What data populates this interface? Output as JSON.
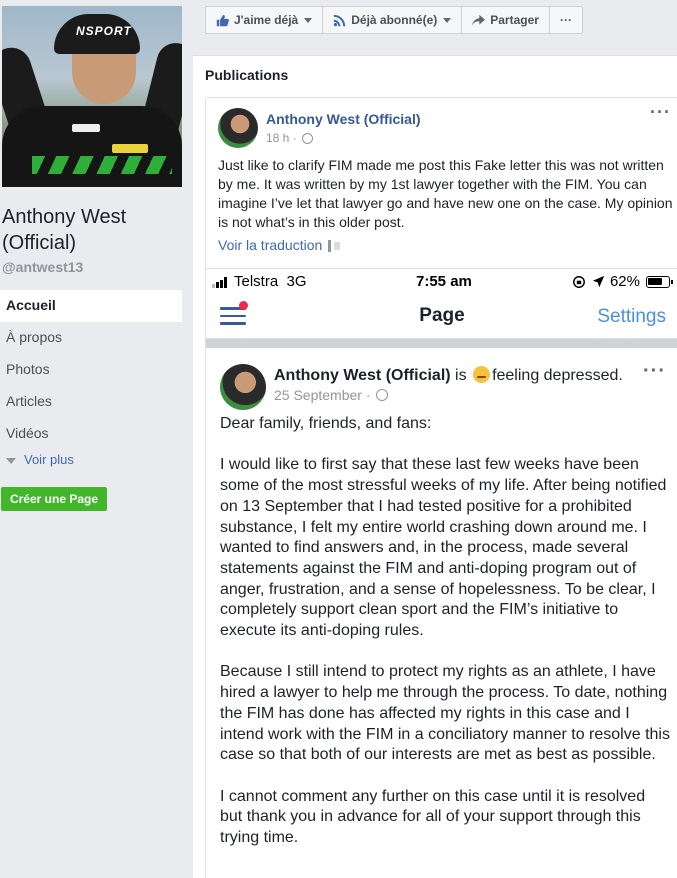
{
  "left": {
    "page_name": "Anthony West (Official)",
    "handle": "@antwest13",
    "photo_cap_text": "NSPORT",
    "nav": [
      {
        "label": "Accueil",
        "active": true
      },
      {
        "label": "À propos",
        "active": false
      },
      {
        "label": "Photos",
        "active": false
      },
      {
        "label": "Articles",
        "active": false
      },
      {
        "label": "Vidéos",
        "active": false
      }
    ],
    "see_more": "Voir plus",
    "create_page": "Créer une Page"
  },
  "actions": {
    "like": "J'aime déjà",
    "follow": "Déjà abonné(e)",
    "share": "Partager",
    "more": "···"
  },
  "publications": {
    "title": "Publications",
    "post": {
      "author": "Anthony West (Official)",
      "time": "18 h ·",
      "more": "···",
      "text": "Just like to clarify FIM made me post this Fake letter this was not written by me. It was written by my 1st lawyer together with the FIM. You can imagine I’ve let that lawyer go and have new one on the case. My opinion is not what’s in this older post.",
      "translate": "Voir la traduction"
    }
  },
  "screenshot": {
    "status": {
      "carrier": "Telstra",
      "network": "3G",
      "time": "7:55 am",
      "battery": "62%"
    },
    "appbar": {
      "title": "Page",
      "settings": "Settings"
    },
    "post": {
      "author": "Anthony West (Official)",
      "feeling_prefix": "is",
      "feeling": "feeling depressed.",
      "date": "25 September ·",
      "more": "···",
      "paragraphs": [
        "Dear family, friends, and fans:",
        "I would like to first say that these last few weeks have been some of the most stressful weeks of my life. After being notified on 13 September that I had tested positive for a prohibited substance, I felt my entire world crashing down around me. I wanted to find answers and, in the process, made several statements against the FIM and anti-doping program out of anger, frustration, and a sense of hopelessness. To be clear, I completely support clean sport and the FIM’s initiative to execute its anti-doping rules.",
        "Because I still intend to protect my rights as an athlete, I have hired a lawyer to help me through the process. To date, nothing the FIM has done has affected my rights in this case and I intend work with the FIM in a conciliatory manner to resolve this case so that both of our interests are met as best as possible.",
        "I cannot comment any further on this case until it is resolved but thank you in advance for all of your support through this trying time."
      ]
    }
  },
  "colors": {
    "link": "#365899",
    "green_button": "#42b72a",
    "settings_blue": "#4a90e2",
    "background": "#e9ebee"
  }
}
